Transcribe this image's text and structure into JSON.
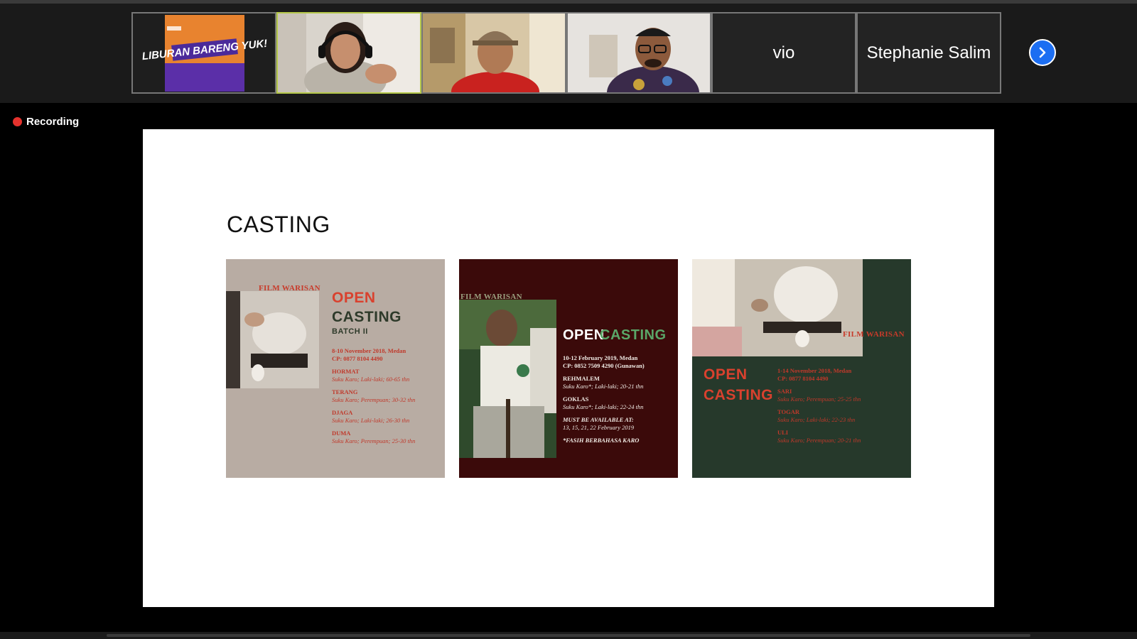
{
  "participants": [
    {
      "name": "",
      "type": "video",
      "tile_text": "LIBURAN BARENG YUK!"
    },
    {
      "name": "",
      "type": "video",
      "active_speaker": true
    },
    {
      "name": "",
      "type": "video"
    },
    {
      "name": "",
      "type": "video"
    },
    {
      "name": "vio",
      "type": "name-only"
    },
    {
      "name": "Stephanie Salim",
      "type": "name-only"
    }
  ],
  "next_page_icon": "chevron-right-icon",
  "recording": {
    "label": "Recording",
    "color": "#e5322d"
  },
  "slide": {
    "title": "CASTING",
    "posters": [
      {
        "bg": "#b8aca3",
        "film": "FILM WARISAN",
        "heading_1": "OPEN",
        "heading_2": "CASTING",
        "subheading": "BATCH II",
        "date_line": "8-10 November 2018, Medan",
        "cp_line": "CP: 0877 8104 4490",
        "roles": [
          {
            "name": "HORMAT",
            "desc": "Suku Karo; Laki-laki; 60-65 thn"
          },
          {
            "name": "TERANG",
            "desc": "Suku Karo; Perempuan; 30-32 thn"
          },
          {
            "name": "DJAGA",
            "desc": "Suku Karo; Laki-laki; 26-30 thn"
          },
          {
            "name": "DUMA",
            "desc": "Suku Karo; Perempuan; 25-30 thn"
          }
        ]
      },
      {
        "bg": "#3b0a0a",
        "film": "FILM WARISAN",
        "heading_1": "OPEN",
        "heading_2": "CASTING",
        "date_line": "10-12 February 2019, Medan",
        "cp_line": "CP: 0852 7509 4290 (Gunawan)",
        "roles": [
          {
            "name": "REHMALEM",
            "desc": "Suku Karo*; Laki-laki; 20-21 thn"
          },
          {
            "name": "GOKLAS",
            "desc": "Suku Karo*; Laki-laki; 22-24 thn"
          }
        ],
        "availability_title": "MUST BE AVAILABLE AT:",
        "availability_dates": "13, 15, 21, 22 February 2019",
        "footnote": "*FASIH BERBAHASA KARO"
      },
      {
        "bg": "#26392b",
        "film": "FILM WARISAN",
        "heading_1": "OPEN",
        "heading_2": "CASTING",
        "date_line": "1-14 November 2018, Medan",
        "cp_line": "CP: 0877 8104 4490",
        "roles": [
          {
            "name": "SARI",
            "desc": "Suku Karo; Perempuan; 25-25 thn"
          },
          {
            "name": "TOGAR",
            "desc": "Suku Karo; Laki-laki; 22-23 thn"
          },
          {
            "name": "ULI",
            "desc": "Suku Karo; Perempuan; 20-21 thn"
          }
        ]
      }
    ]
  },
  "colors": {
    "toolbar_bg": "#1a1a1a",
    "accent_blue": "#1c6ef2",
    "active_speaker_border": "#b5c84a",
    "poster_red": "#d9412e",
    "poster_green": "#5aa668"
  }
}
